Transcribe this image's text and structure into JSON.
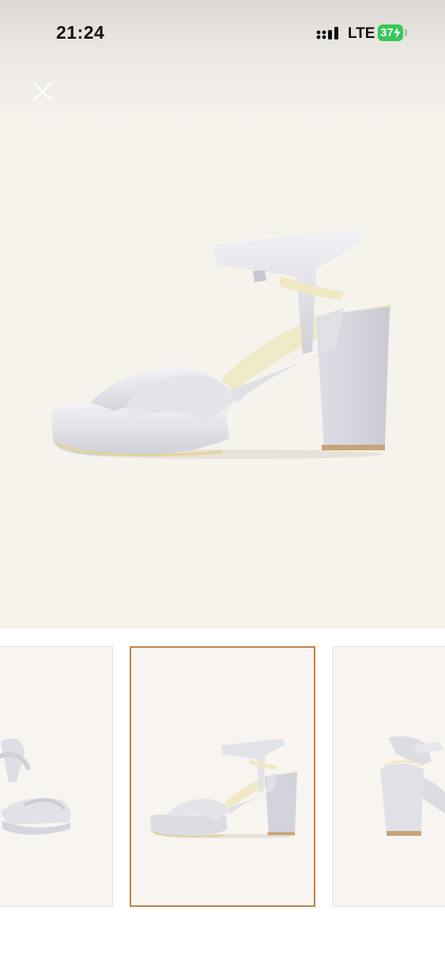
{
  "status_bar": {
    "time": "21:24",
    "network": "LTE",
    "battery": "37",
    "icons": [
      "signal-icon",
      "charging-bolt-icon"
    ]
  },
  "header": {
    "close_icon": "close-icon"
  },
  "gallery": {
    "main_image": "white-satin-platform-sandal-side-view",
    "thumbnails": [
      {
        "view": "front-angle",
        "selected": false
      },
      {
        "view": "side",
        "selected": true
      },
      {
        "view": "back",
        "selected": false
      }
    ]
  },
  "colors": {
    "hero_background": "#f6f2ec",
    "selection_border": "#c08445",
    "battery_green": "#34c759"
  }
}
